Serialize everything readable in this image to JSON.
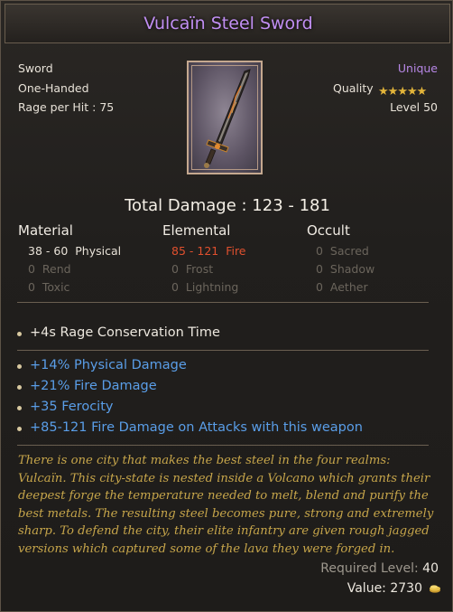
{
  "item": {
    "name": "Vulcaïn Steel Sword",
    "type": "Sword",
    "handedness": "One-Handed",
    "rage_per_hit": "Rage per Hit : 75",
    "rarity": "Unique",
    "quality_label": "Quality",
    "quality_stars": 5,
    "level": "Level 50",
    "total_damage": "Total Damage : 123 - 181",
    "color_rarity": "#b787e6",
    "color_title": "#c08ef2"
  },
  "damage_columns": {
    "material": {
      "header": "Material",
      "rows": [
        {
          "value": "38 - 60",
          "name": "Physical"
        },
        {
          "value": "0",
          "name": "Rend"
        },
        {
          "value": "0",
          "name": "Toxic"
        }
      ]
    },
    "elemental": {
      "header": "Elemental",
      "rows": [
        {
          "value": "85 - 121",
          "name": "Fire"
        },
        {
          "value": "0",
          "name": "Frost"
        },
        {
          "value": "0",
          "name": "Lightning"
        }
      ]
    },
    "occult": {
      "header": "Occult",
      "rows": [
        {
          "value": "0",
          "name": "Sacred"
        },
        {
          "value": "0",
          "name": "Shadow"
        },
        {
          "value": "0",
          "name": "Aether"
        }
      ]
    }
  },
  "implicit_affix": "+4s Rage Conservation Time",
  "affixes": [
    "+14% Physical Damage",
    "+21% Fire Damage",
    "+35 Ferocity",
    "+85-121 Fire Damage on Attacks with this weapon"
  ],
  "lore": "There is one city that makes the best steel in the four realms: Vulcaïn. This city-state is nested inside a Volcano which grants their deepest forge the temperature needed to melt, blend and purify the best metals. The resulting steel becomes pure, strong and extremely sharp. To defend the city, their elite infantry are given rough jagged versions which captured some of the lava they were forged in.",
  "footer": {
    "required_level_label": "Required Level:",
    "required_level": "40",
    "value_label": "Value:",
    "value": "2730",
    "currency_icon": "gold-coins-icon"
  }
}
